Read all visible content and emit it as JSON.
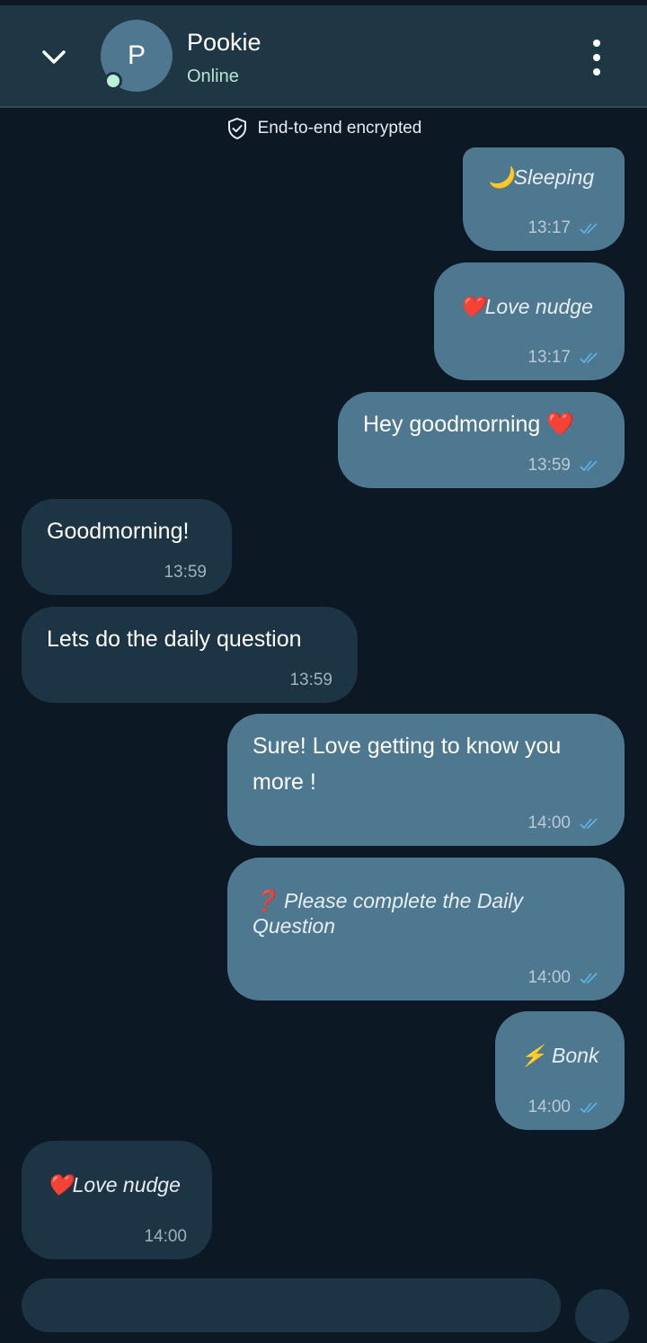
{
  "header": {
    "contact_name": "Pookie",
    "status": "Online",
    "avatar_letter": "P"
  },
  "encryption_notice": "End-to-end encrypted",
  "messages": [
    {
      "dir": "out",
      "style": "italic",
      "emoji": "🌙",
      "text": "Sleeping",
      "time": "13:17",
      "ticks": true
    },
    {
      "dir": "out",
      "style": "italic",
      "emoji": "❤️",
      "text": "Love nudge",
      "time": "13:17",
      "ticks": true
    },
    {
      "dir": "out",
      "style": "normal",
      "emoji": "",
      "text": "Hey goodmorning ❤️",
      "time": "13:59",
      "ticks": true
    },
    {
      "dir": "in",
      "style": "normal",
      "emoji": "",
      "text": "Goodmorning!",
      "time": "13:59",
      "ticks": false
    },
    {
      "dir": "in",
      "style": "normal",
      "emoji": "",
      "text": "Lets do the daily question",
      "time": "13:59",
      "ticks": false
    },
    {
      "dir": "out",
      "style": "normal",
      "emoji": "",
      "text": "Sure! Love getting to know you more !",
      "time": "14:00",
      "ticks": true
    },
    {
      "dir": "out",
      "style": "italic",
      "emoji": "❓",
      "text": "Please complete the Daily Question",
      "time": "14:00",
      "ticks": true
    },
    {
      "dir": "out",
      "style": "italic",
      "emoji": "⚡",
      "text": "Bonk",
      "time": "14:00",
      "ticks": true
    },
    {
      "dir": "in",
      "style": "italic",
      "emoji": "❤️",
      "text": "Love nudge",
      "time": "14:00",
      "ticks": false
    }
  ],
  "colors": {
    "background": "#0c1824",
    "header": "#1f3645",
    "outgoing_bubble": "#4e7890",
    "incoming_bubble": "#1c3444",
    "read_ticks": "#5fb3e8",
    "online_dot": "#b9f1d9"
  }
}
